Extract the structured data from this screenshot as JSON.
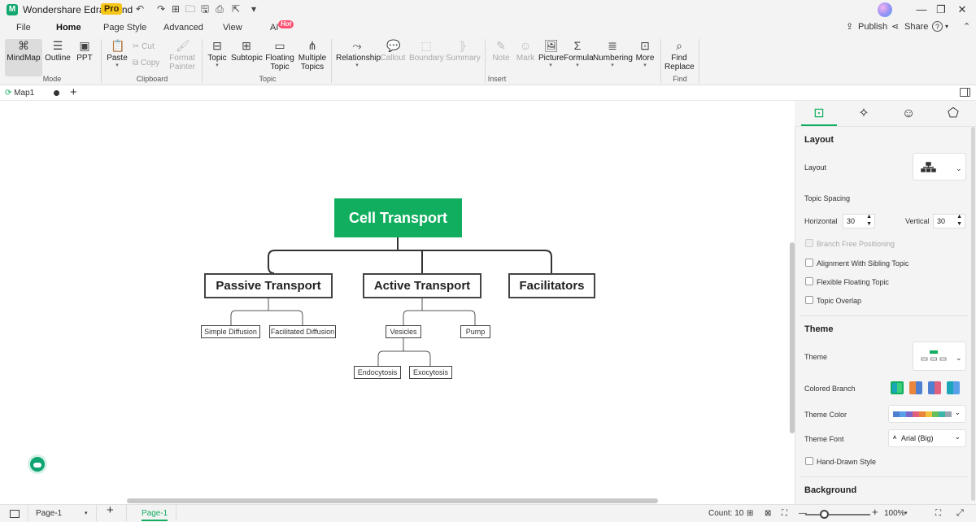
{
  "app": {
    "title": "Wondershare EdrawMind",
    "badge": "Pro",
    "logo_glyph": "M"
  },
  "quick_access": {
    "undo": "↶",
    "redo": "↷",
    "new": "⊞",
    "open": "🗀",
    "save": "🖫",
    "print": "⎙",
    "export": "⇱",
    "more": "▾"
  },
  "window": {
    "min": "—",
    "restore": "❐",
    "close": "✕"
  },
  "menu": {
    "tabs": [
      "File",
      "Home",
      "Page Style",
      "Advanced",
      "View",
      "AI"
    ],
    "active": "Home",
    "ai_badge": "Hot"
  },
  "topright": {
    "publish": "Publish",
    "share": "Share",
    "help": "?"
  },
  "ribbon": {
    "mode": {
      "label": "Mode",
      "items": [
        "MindMap",
        "Outline",
        "PPT"
      ]
    },
    "clipboard": {
      "label": "Clipboard",
      "paste": "Paste",
      "cut": "Cut",
      "copy": "Copy",
      "format_painter_1": "Format",
      "format_painter_2": "Painter"
    },
    "topic": {
      "label": "Topic",
      "topic": "Topic",
      "subtopic": "Subtopic",
      "floating_1": "Floating",
      "floating_2": "Topic",
      "multiple_1": "Multiple",
      "multiple_2": "Topics"
    },
    "insert": {
      "label": "Insert",
      "items": [
        "Relationship",
        "Callout",
        "Boundary",
        "Summary",
        "Note",
        "Mark",
        "Picture",
        "Formula",
        "Numbering",
        "More"
      ]
    },
    "find": {
      "label": "Find",
      "find_1": "Find",
      "find_2": "Replace"
    }
  },
  "document": {
    "tab": "Map1"
  },
  "mindmap": {
    "root": "Cell Transport",
    "branches": [
      {
        "label": "Passive Transport",
        "children": [
          "Simple Diffusion",
          "Facilitated Diffusion"
        ]
      },
      {
        "label": "Active Transport",
        "children": [
          "Vesicles",
          "Pump"
        ],
        "grandchildren": [
          "Endocytosis",
          "Exocytosis"
        ]
      },
      {
        "label": "Facilitators",
        "children": []
      }
    ]
  },
  "panel": {
    "layout_heading": "Layout",
    "layout_label": "Layout",
    "topic_spacing": "Topic Spacing",
    "horizontal_label": "Horizontal",
    "horizontal_value": "30",
    "vertical_label": "Vertical",
    "vertical_value": "30",
    "checks": [
      "Branch Free Positioning",
      "Alignment With Sibling Topic",
      "Flexible Floating Topic",
      "Topic Overlap"
    ],
    "theme_heading": "Theme",
    "theme_label": "Theme",
    "colored_branch": "Colored Branch",
    "theme_color": "Theme Color",
    "theme_font": "Theme Font",
    "theme_font_value": "Arial (Big)",
    "hand_drawn": "Hand-Drawn Style",
    "background_heading": "Background",
    "accent": "#12ae60",
    "theme_palette": [
      "#4f7fd1",
      "#5aa0e8",
      "#7b68c9",
      "#e0607e",
      "#e9863b",
      "#f2c33c",
      "#6bbf5a",
      "#3ab6a8",
      "#9aa5b1"
    ]
  },
  "status": {
    "page_select": "Page-1",
    "active_page": "Page-1",
    "count": "Count: 10",
    "zoom": "100%"
  }
}
